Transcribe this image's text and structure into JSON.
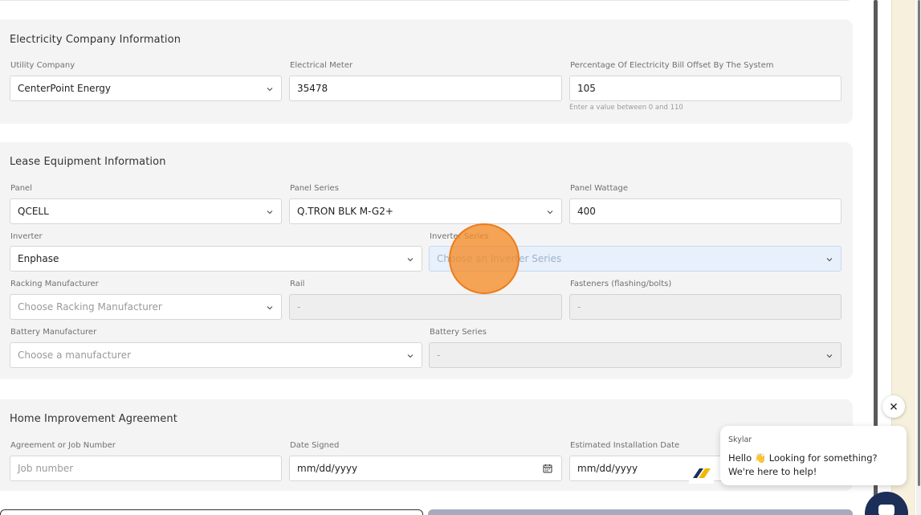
{
  "electricity": {
    "title": "Electricity Company Information",
    "utility_label": "Utility Company",
    "utility_value": "CenterPoint Energy",
    "meter_label": "Electrical Meter",
    "meter_value": "35478",
    "offset_label": "Percentage Of Electricity Bill Offset By The System",
    "offset_value": "105",
    "offset_help": "Enter a value between 0 and 110"
  },
  "lease": {
    "title": "Lease Equipment Information",
    "panel_label": "Panel",
    "panel_value": "QCELL",
    "panel_series_label": "Panel Series",
    "panel_series_value": "Q.TRON BLK M-G2+",
    "panel_wattage_label": "Panel Wattage",
    "panel_wattage_value": "400",
    "inverter_label": "Inverter",
    "inverter_value": "Enphase",
    "inverter_series_label": "Inverter Series",
    "inverter_series_placeholder": "Choose an Inverter Series",
    "racking_label": "Racking Manufacturer",
    "racking_placeholder": "Choose Racking Manufacturer",
    "rail_label": "Rail",
    "rail_value": "-",
    "fasteners_label": "Fasteners (flashing/bolts)",
    "fasteners_value": "-",
    "battery_mfr_label": "Battery Manufacturer",
    "battery_mfr_placeholder": "Choose a manufacturer",
    "battery_series_label": "Battery Series",
    "battery_series_value": "-"
  },
  "agreement": {
    "title": "Home Improvement Agreement",
    "job_label": "Agreement or Job Number",
    "job_placeholder": "Job number",
    "date_signed_label": "Date Signed",
    "date_signed_value": "mm/dd/yyyy",
    "install_label": "Estimated Installation Date",
    "install_value": "mm/dd/yyyy"
  },
  "chat": {
    "agent_name": "Skylar",
    "message": "Hello 👋 Looking for something? We're here to help!"
  },
  "colors": {
    "section_bg": "#f4f4f4",
    "highlight_bg": "#e7f0fb",
    "cursor": "#f58c28",
    "chat_launcher": "#1c2f59",
    "button_filled": "#a7a9bd"
  },
  "icons": [
    "chevron-down-icon",
    "calendar-icon",
    "close-icon",
    "chat-icon",
    "brand-logo-icon"
  ]
}
